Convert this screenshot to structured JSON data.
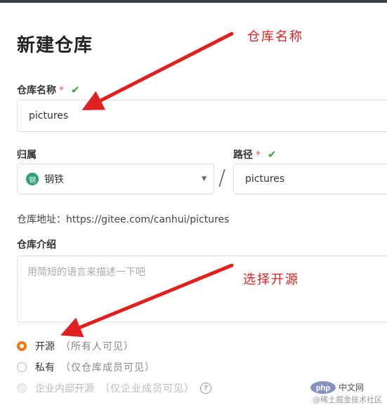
{
  "title": "新建仓库",
  "repo_name": {
    "label": "仓库名称",
    "required_mark": "*",
    "value": "pictures"
  },
  "owner": {
    "label": "归属",
    "avatar_text": "钢",
    "value": "钢铁"
  },
  "separator": "/",
  "path": {
    "label": "路径",
    "required_mark": "*",
    "value": "pictures"
  },
  "repo_address": "仓库地址：https://gitee.com/canhui/pictures",
  "description": {
    "label": "仓库介绍",
    "placeholder": "用简短的语言来描述一下吧"
  },
  "visibility": {
    "options": [
      {
        "label": "开源",
        "sub": "（所有人可见）",
        "checked": true,
        "disabled": false
      },
      {
        "label": "私有",
        "sub": "（仅仓库成员可见）",
        "checked": false,
        "disabled": false
      },
      {
        "label": "企业内部开源",
        "sub": "（仅企业成员可见）",
        "checked": false,
        "disabled": true
      }
    ]
  },
  "annotations": {
    "repo_name_note": "仓库名称",
    "open_source_note": "选择开源"
  },
  "watermark": {
    "logo": "php",
    "logo_suffix": "中文网",
    "text": "@稀土掘金技术社区"
  },
  "colors": {
    "accent": "#f07a1a",
    "check": "#3aa33a",
    "annotation": "#e02020"
  }
}
